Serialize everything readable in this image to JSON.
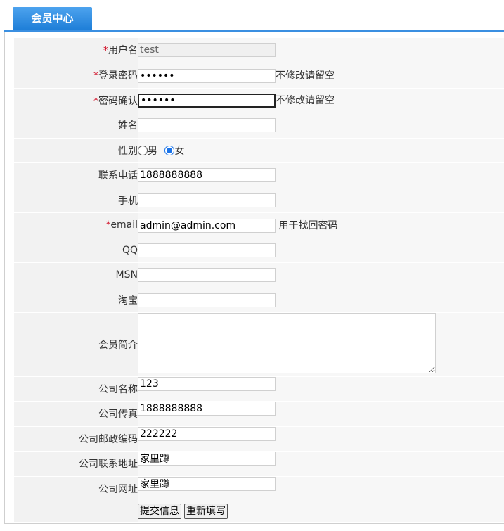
{
  "header": {
    "tab_title": "会员中心"
  },
  "form": {
    "username": {
      "label": "用户名",
      "required": "*",
      "value": "test"
    },
    "password": {
      "label": "登录密码",
      "required": "*",
      "value": "••••••",
      "hint": "不修改请留空"
    },
    "password_confirm": {
      "label": "密码确认",
      "required": "*",
      "value": "••••••",
      "hint": "不修改请留空"
    },
    "name": {
      "label": "姓名",
      "value": ""
    },
    "gender": {
      "label": "性别",
      "options": [
        "男",
        "女"
      ],
      "selected": "女"
    },
    "phone": {
      "label": "联系电话",
      "value": "1888888888"
    },
    "mobile": {
      "label": "手机",
      "value": ""
    },
    "email": {
      "label": "email",
      "required": "*",
      "value": "admin@admin.com",
      "hint": "用于找回密码"
    },
    "qq": {
      "label": "QQ",
      "value": ""
    },
    "msn": {
      "label": "MSN",
      "value": ""
    },
    "taobao": {
      "label": "淘宝",
      "value": ""
    },
    "intro": {
      "label": "会员简介",
      "value": ""
    },
    "company_name": {
      "label": "公司名称",
      "value": "123"
    },
    "company_fax": {
      "label": "公司传真",
      "value": "1888888888"
    },
    "company_zip": {
      "label": "公司邮政编码",
      "value": "222222"
    },
    "company_address": {
      "label": "公司联系地址",
      "value": "家里蹲"
    },
    "company_url": {
      "label": "公司网址",
      "value": "家里蹲"
    },
    "submit_label": "提交信息",
    "reset_label": "重新填写"
  },
  "colors": {
    "tab_blue": "#1f7fd8",
    "required_red": "#d0021b",
    "label_bg": "#f2f2f2"
  }
}
